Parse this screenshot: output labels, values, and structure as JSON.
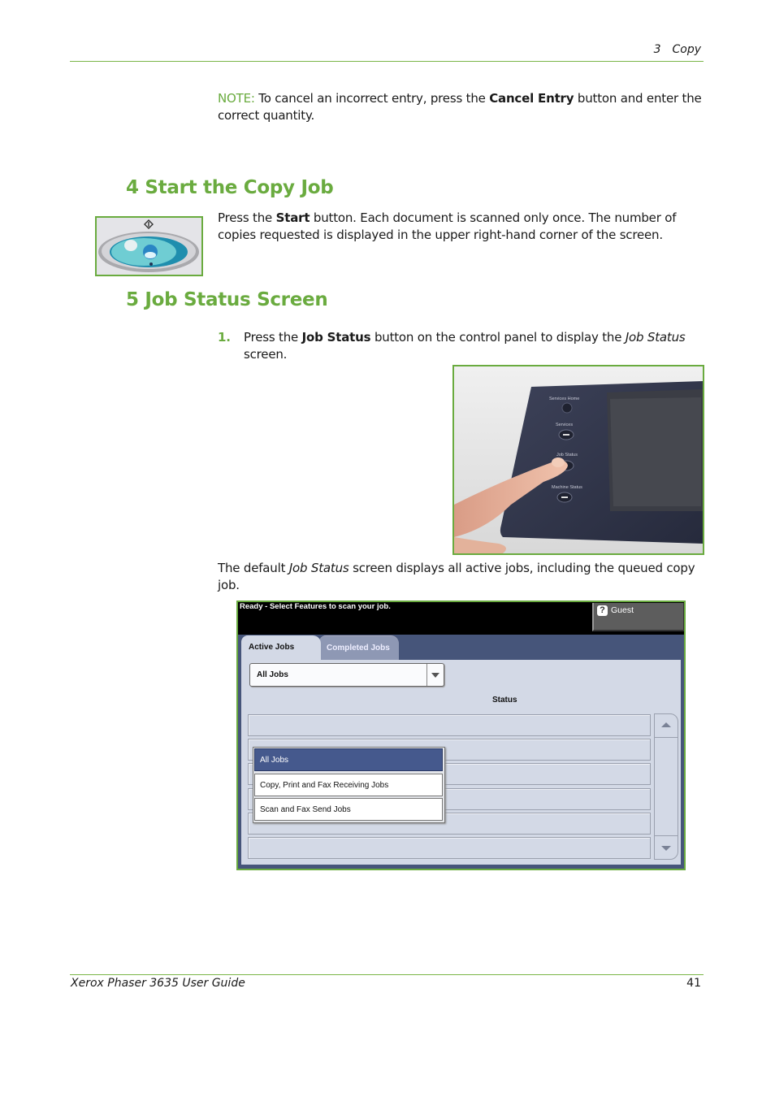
{
  "header": {
    "chapter_number": "3",
    "chapter_title": "Copy"
  },
  "note": {
    "label": "NOTE:",
    "text_before": " To cancel an incorrect entry, press the ",
    "bold": "Cancel Entry",
    "text_after": " button and enter the correct quantity."
  },
  "section4": {
    "title": "4 Start the Copy Job",
    "image_alt": "Start button",
    "text_before": "Press the ",
    "bold": "Start",
    "text_after": " button. Each document is scanned only once. The number of copies requested is displayed in the upper right-hand corner of the screen."
  },
  "section5": {
    "title": "5 Job Status Screen",
    "step_number": "1.",
    "step_before": "Press the ",
    "step_bold": "Job Status",
    "step_middle": " button on the control panel to display the ",
    "step_italic": "Job Status",
    "step_after": " screen.",
    "photo_labels": [
      "Services Home",
      "Services",
      "Job Status",
      "Machine Status"
    ],
    "para_before": "The default ",
    "para_italic": "Job Status",
    "para_after": " screen displays all active jobs, including the queued copy job."
  },
  "job_status_ui": {
    "status_message": "Ready - Select Features to scan your job.",
    "user_icon": "help-icon",
    "user_label": "Guest",
    "tabs": [
      {
        "label": "Active Jobs",
        "active": true
      },
      {
        "label": "Completed Jobs",
        "active": false
      }
    ],
    "filter_value": "All Jobs",
    "filter_options": [
      {
        "label": "All Jobs",
        "selected": true
      },
      {
        "label": "Copy, Print and Fax Receiving Jobs",
        "selected": false
      },
      {
        "label": "Scan and Fax Send Jobs",
        "selected": false
      }
    ],
    "column_header": "Status",
    "rows": [
      "",
      "",
      "",
      "",
      "",
      ""
    ]
  },
  "footer": {
    "guide_title": "Xerox Phaser 3635 User Guide",
    "page_number": "41"
  },
  "colors": {
    "accent_green": "#6aab3f",
    "ui_navy": "#46557a",
    "ui_selected": "#45598d"
  }
}
